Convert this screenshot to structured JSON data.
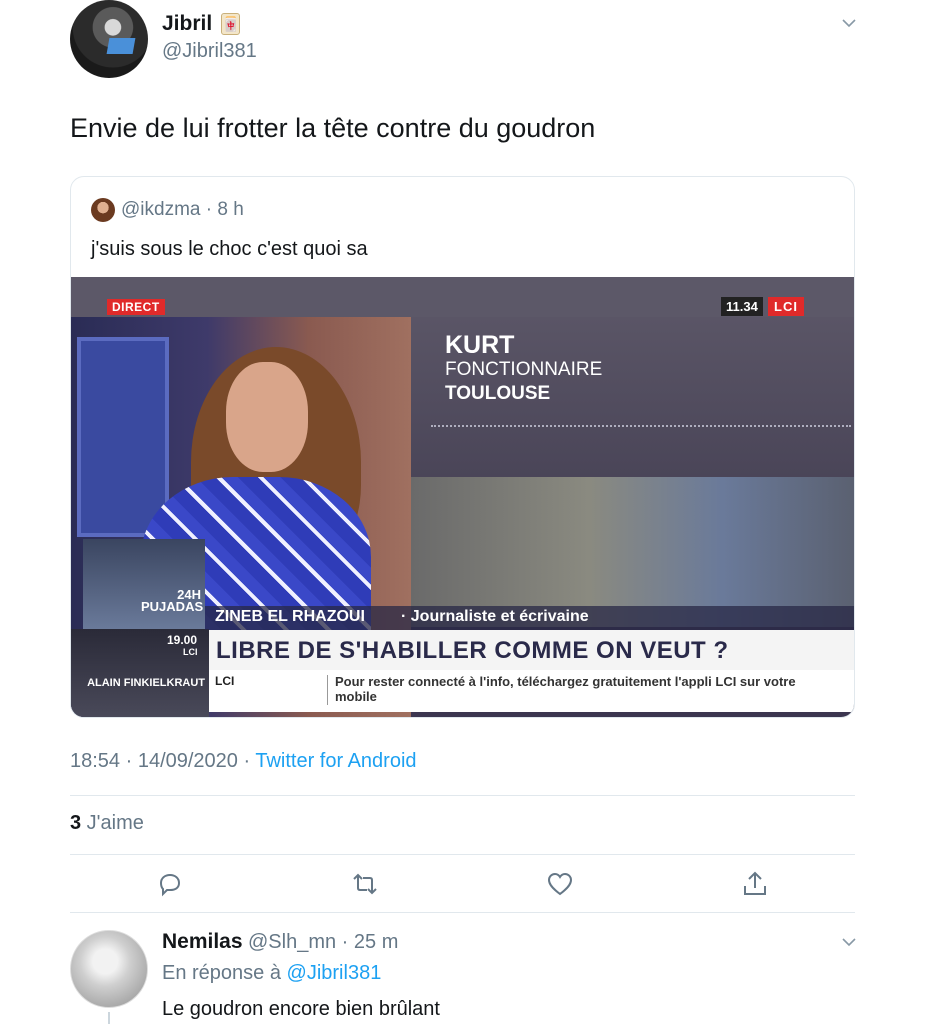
{
  "tweet": {
    "author_name": "Jibril",
    "author_badge": "🀄",
    "author_handle": "@Jibril381",
    "text": "Envie de lui frotter la tête contre du goudron",
    "timestamp": "18:54 · 14/09/2020",
    "meta_separator": " · ",
    "source": "Twitter for Android",
    "likes_count": "3",
    "likes_label": " J'aime"
  },
  "quoted": {
    "handle_time": "@ikdzma · 8 h",
    "text": "j'suis sous le choc c'est quoi sa",
    "video": {
      "live_label": "DIRECT",
      "clock": "11.34",
      "channel": "LCI",
      "guest_name": "KURT",
      "guest_role": "FONCTIONNAIRE",
      "guest_city": "TOULOUSE",
      "thumb1_label": "24H PUJADAS",
      "thumb2_time": "19.00",
      "thumb2_channel": "LCI",
      "thumb2_name": "ALAIN FINKIELKRAUT",
      "speaker_name": "ZINEB EL RHAZOUI",
      "speaker_role": "· Journaliste et écrivaine",
      "headline": "LIBRE DE S'HABILLER COMME ON VEUT ?",
      "ticker_channel": "LCI",
      "ticker_text": "Pour rester connecté à l'info, téléchargez gratuitement l'appli LCI sur votre mobile"
    }
  },
  "actions": [
    "reply-icon",
    "retweet-icon",
    "like-icon",
    "share-icon"
  ],
  "reply": {
    "author_name": "Nemilas",
    "meta": "@Slh_mn · 25 m",
    "in_reply_prefix": "En réponse à ",
    "in_reply_mention": "@Jibril381",
    "text": "Le goudron encore bien brûlant"
  },
  "colors": {
    "link": "#1da1f2",
    "secondary_text": "#657786",
    "divider": "#e1e8ed"
  }
}
